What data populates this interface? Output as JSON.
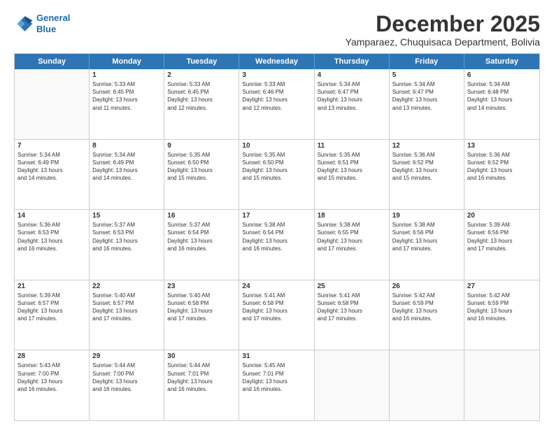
{
  "logo": {
    "line1": "General",
    "line2": "Blue"
  },
  "header": {
    "month": "December 2025",
    "location": "Yamparaez, Chuquisaca Department, Bolivia"
  },
  "weekdays": [
    "Sunday",
    "Monday",
    "Tuesday",
    "Wednesday",
    "Thursday",
    "Friday",
    "Saturday"
  ],
  "rows": [
    [
      {
        "day": "",
        "lines": []
      },
      {
        "day": "1",
        "lines": [
          "Sunrise: 5:33 AM",
          "Sunset: 6:45 PM",
          "Daylight: 13 hours",
          "and 11 minutes."
        ]
      },
      {
        "day": "2",
        "lines": [
          "Sunrise: 5:33 AM",
          "Sunset: 6:45 PM",
          "Daylight: 13 hours",
          "and 12 minutes."
        ]
      },
      {
        "day": "3",
        "lines": [
          "Sunrise: 5:33 AM",
          "Sunset: 6:46 PM",
          "Daylight: 13 hours",
          "and 12 minutes."
        ]
      },
      {
        "day": "4",
        "lines": [
          "Sunrise: 5:34 AM",
          "Sunset: 6:47 PM",
          "Daylight: 13 hours",
          "and 13 minutes."
        ]
      },
      {
        "day": "5",
        "lines": [
          "Sunrise: 5:34 AM",
          "Sunset: 6:47 PM",
          "Daylight: 13 hours",
          "and 13 minutes."
        ]
      },
      {
        "day": "6",
        "lines": [
          "Sunrise: 5:34 AM",
          "Sunset: 6:48 PM",
          "Daylight: 13 hours",
          "and 14 minutes."
        ]
      }
    ],
    [
      {
        "day": "7",
        "lines": [
          "Sunrise: 5:34 AM",
          "Sunset: 6:49 PM",
          "Daylight: 13 hours",
          "and 14 minutes."
        ]
      },
      {
        "day": "8",
        "lines": [
          "Sunrise: 5:34 AM",
          "Sunset: 6:49 PM",
          "Daylight: 13 hours",
          "and 14 minutes."
        ]
      },
      {
        "day": "9",
        "lines": [
          "Sunrise: 5:35 AM",
          "Sunset: 6:50 PM",
          "Daylight: 13 hours",
          "and 15 minutes."
        ]
      },
      {
        "day": "10",
        "lines": [
          "Sunrise: 5:35 AM",
          "Sunset: 6:50 PM",
          "Daylight: 13 hours",
          "and 15 minutes."
        ]
      },
      {
        "day": "11",
        "lines": [
          "Sunrise: 5:35 AM",
          "Sunset: 6:51 PM",
          "Daylight: 13 hours",
          "and 15 minutes."
        ]
      },
      {
        "day": "12",
        "lines": [
          "Sunrise: 5:36 AM",
          "Sunset: 6:52 PM",
          "Daylight: 13 hours",
          "and 15 minutes."
        ]
      },
      {
        "day": "13",
        "lines": [
          "Sunrise: 5:36 AM",
          "Sunset: 6:52 PM",
          "Daylight: 13 hours",
          "and 16 minutes."
        ]
      }
    ],
    [
      {
        "day": "14",
        "lines": [
          "Sunrise: 5:36 AM",
          "Sunset: 6:53 PM",
          "Daylight: 13 hours",
          "and 16 minutes."
        ]
      },
      {
        "day": "15",
        "lines": [
          "Sunrise: 5:37 AM",
          "Sunset: 6:53 PM",
          "Daylight: 13 hours",
          "and 16 minutes."
        ]
      },
      {
        "day": "16",
        "lines": [
          "Sunrise: 5:37 AM",
          "Sunset: 6:54 PM",
          "Daylight: 13 hours",
          "and 16 minutes."
        ]
      },
      {
        "day": "17",
        "lines": [
          "Sunrise: 5:38 AM",
          "Sunset: 6:54 PM",
          "Daylight: 13 hours",
          "and 16 minutes."
        ]
      },
      {
        "day": "18",
        "lines": [
          "Sunrise: 5:38 AM",
          "Sunset: 6:55 PM",
          "Daylight: 13 hours",
          "and 17 minutes."
        ]
      },
      {
        "day": "19",
        "lines": [
          "Sunrise: 5:38 AM",
          "Sunset: 6:56 PM",
          "Daylight: 13 hours",
          "and 17 minutes."
        ]
      },
      {
        "day": "20",
        "lines": [
          "Sunrise: 5:39 AM",
          "Sunset: 6:56 PM",
          "Daylight: 13 hours",
          "and 17 minutes."
        ]
      }
    ],
    [
      {
        "day": "21",
        "lines": [
          "Sunrise: 5:39 AM",
          "Sunset: 6:57 PM",
          "Daylight: 13 hours",
          "and 17 minutes."
        ]
      },
      {
        "day": "22",
        "lines": [
          "Sunrise: 5:40 AM",
          "Sunset: 6:57 PM",
          "Daylight: 13 hours",
          "and 17 minutes."
        ]
      },
      {
        "day": "23",
        "lines": [
          "Sunrise: 5:40 AM",
          "Sunset: 6:58 PM",
          "Daylight: 13 hours",
          "and 17 minutes."
        ]
      },
      {
        "day": "24",
        "lines": [
          "Sunrise: 5:41 AM",
          "Sunset: 6:58 PM",
          "Daylight: 13 hours",
          "and 17 minutes."
        ]
      },
      {
        "day": "25",
        "lines": [
          "Sunrise: 5:41 AM",
          "Sunset: 6:58 PM",
          "Daylight: 13 hours",
          "and 17 minutes."
        ]
      },
      {
        "day": "26",
        "lines": [
          "Sunrise: 5:42 AM",
          "Sunset: 6:59 PM",
          "Daylight: 13 hours",
          "and 16 minutes."
        ]
      },
      {
        "day": "27",
        "lines": [
          "Sunrise: 5:42 AM",
          "Sunset: 6:59 PM",
          "Daylight: 13 hours",
          "and 16 minutes."
        ]
      }
    ],
    [
      {
        "day": "28",
        "lines": [
          "Sunrise: 5:43 AM",
          "Sunset: 7:00 PM",
          "Daylight: 13 hours",
          "and 16 minutes."
        ]
      },
      {
        "day": "29",
        "lines": [
          "Sunrise: 5:44 AM",
          "Sunset: 7:00 PM",
          "Daylight: 13 hours",
          "and 16 minutes."
        ]
      },
      {
        "day": "30",
        "lines": [
          "Sunrise: 5:44 AM",
          "Sunset: 7:01 PM",
          "Daylight: 13 hours",
          "and 16 minutes."
        ]
      },
      {
        "day": "31",
        "lines": [
          "Sunrise: 5:45 AM",
          "Sunset: 7:01 PM",
          "Daylight: 13 hours",
          "and 16 minutes."
        ]
      },
      {
        "day": "",
        "lines": []
      },
      {
        "day": "",
        "lines": []
      },
      {
        "day": "",
        "lines": []
      }
    ]
  ]
}
